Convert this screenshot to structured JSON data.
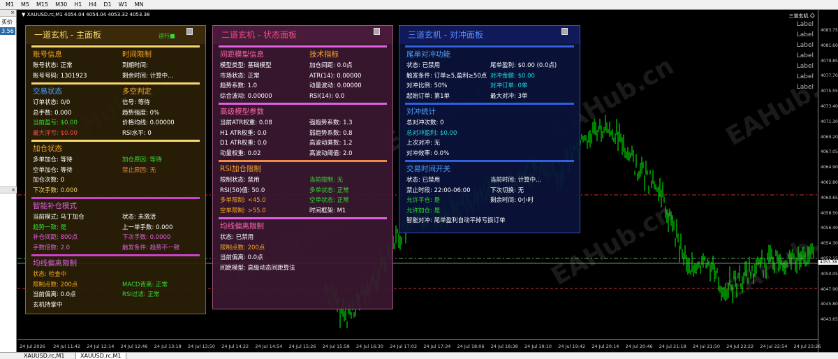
{
  "toolbar": {
    "items": [
      "M1",
      "M5",
      "M15",
      "M30",
      "H1",
      "H4",
      "D1",
      "W1",
      "MN"
    ]
  },
  "left": {
    "label": "买价",
    "value": "3.56"
  },
  "chart": {
    "title": "▼ XAUUSD.rc,M1   4054.04 4054.04 4053.32 4053.38",
    "ea_name": "三道玄机 ☺",
    "labels": [
      "Label",
      "Label",
      "Label",
      "Label",
      "Label",
      "Label",
      "Label"
    ]
  },
  "price_axis": [
    "4083.75",
    "4081.60",
    "4079.85",
    "4077.70",
    "4075.55",
    "4073.40",
    "4071.30",
    "4069.20",
    "4067.05",
    "4064.90",
    "4062.80",
    "4060.65",
    "4058.50",
    "4056.40",
    "4054.30",
    "4053.38",
    "4052.15",
    "4050.05",
    "4047.90",
    "4045.80",
    "4043.65"
  ],
  "time_axis": [
    "24 Jul 2026",
    "24 Jul 11:42",
    "24 Jul 12:14",
    "24 Jul 12:46",
    "24 Jul 13:18",
    "24 Jul 13:50",
    "24 Jul 14:22",
    "24 Jul 14:54",
    "24 Jul 15:26",
    "24 Jul 15:58",
    "24 Jul 16:30",
    "24 Jul 17:02",
    "24 Jul 17:34",
    "24 Jul 18:06",
    "24 Jul 18:38",
    "24 Jul 19:10",
    "24 Jul 19:42",
    "24 Jul 20:14",
    "24 Jul 20:46",
    "24 Jul 21:18",
    "24 Jul 21:50",
    "24 Jul 22:22",
    "24 Jul 22:54",
    "24 Jul 23:26"
  ],
  "tabs": [
    "XAUUSD.rc,M1",
    "XAUUSD.rc,M1"
  ],
  "watermark": "EAHub.cn",
  "colors": {
    "bull_bar": "#00ff00",
    "red_dash": "#cc3333",
    "green_dash": "#55aa55"
  },
  "panel1": {
    "title": "一道玄机 - 主面板",
    "status": "运行■",
    "sec1_a": "账号信息",
    "sec1_b": "时间限制",
    "r1a": "账号状态: 正常",
    "r1b": "到期时间:",
    "r2a": "账号号码: 1301923",
    "r2b": "剩余时间: 计算中...",
    "sec2_a": "交易状态",
    "sec2_b": "多空判定",
    "r3a": "订单状态: 0/0",
    "r3b": "信号: 等待",
    "r4a": "总手数: 0.000",
    "r4b": "趋势强度: 0%",
    "r5a": "当前盈亏: $0.00",
    "r5b": "价格均线: 0.00000",
    "r6a": "最大浮亏: $0.00",
    "r6b": "RSI水平: 0",
    "sec3": "加仓状态",
    "r7a": "多单加仓: 等待",
    "r7b": "加仓原因: 等待",
    "r8a": "空单加仓: 等待",
    "r8b": "禁止原因: 无",
    "r9a": "加仓次数: 0",
    "r10a": "下次手数: 0.000",
    "sec4": "智能补仓模式",
    "r11a": "当前模式: 马丁加仓",
    "r11b": "状态: 未激活",
    "r12a": "趋势一致: 是",
    "r12b": "上一单手数: 0.000",
    "r13a": "补仓间距: 800点",
    "r13b": "下次手数: 0.0000",
    "r14a": "手数倍数: 2.0",
    "r14b": "触发条件: 趋势不一致",
    "sec5": "均线偏离限制",
    "r15a": "状态: 检查中",
    "r16a": "限制点数: 200点",
    "r16b": "MACD背离: 正常",
    "r17a": "当前偏离: 0.0点",
    "r17b": "RSI过滤: 正常",
    "r18a": "玄机持掌中"
  },
  "panel2": {
    "title": "二道玄机 - 状态面板",
    "sec1_a": "间距模型信息",
    "sec1_b": "技术指标",
    "r1a": "模型类型: 基础模型",
    "r1b": "加仓间距: 0.0点",
    "r2a": "市场状态: 正常",
    "r2b": "ATR(14): 0.00000",
    "r3a": "趋势系数: 1.0",
    "r3b": "动量波动: 0.00000",
    "r4a": "综合波动: 0.00000",
    "r4b": "RSI(14): 0.0",
    "sec2": "高级模型参数",
    "r5a": "当前ATR权重: 0.08",
    "r5b": "强趋势系数: 1.3",
    "r6a": "H1 ATR权重: 0.0",
    "r6b": "弱趋势系数: 0.8",
    "r7a": "D1 ATR权重: 0.0",
    "r7b": "高波动乘数: 1.2",
    "r8a": "动量权重: 0.02",
    "r8b": "高波动阈值: 2.0",
    "sec3": "RSI加仓限制",
    "r9a": "限制状态: 禁用",
    "r9b": "当前限制: 无",
    "r10a": "RSI(50)值: 50.0",
    "r10b": "多单状态: 正常",
    "r11a": "多单限制: <45.0",
    "r11b": "空单状态: 正常",
    "r12a": "空单限制: >55.0",
    "r12b": "时间框架: M1",
    "sec4": "均线偏离限制",
    "r13a": "状态: 已禁用",
    "r14a": "限制点数: 200点",
    "r15a": "当前偏离: 0.0点",
    "r16a": "间距模型: 高级动态间距算法"
  },
  "panel3": {
    "title": "三道玄机 - 对冲面板",
    "sec1": "尾单对冲功能",
    "r1a": "状态: 已禁用",
    "r1b": "尾单盈利: $0.00 (0.0点)",
    "r2a": "触发条件: 订单≥5,盈利≥50点",
    "r2b": "对冲金额: $0.00",
    "r3a": "对冲比例: 50%",
    "r3b": "对冲订单: 0单",
    "r4a": "起始订单: 第1单",
    "r4b": "最大对冲: 3单",
    "sec2": "对冲统计",
    "r5a": "总对冲次数: 0",
    "r6a": "总对冲盈利: $0.00",
    "r7a": "上次对冲: 无",
    "r8a": "对冲效率: 0.0%",
    "sec3": "交易时间开关",
    "r9a": "状态: 已禁用",
    "r9b": "当前时间: 计算中...",
    "r10a": "禁止时段: 22:00-06:00",
    "r10b": "下次切换: 无",
    "r11a": "允许平仓: 是",
    "r11b": "剩余时间: 0小时",
    "r12a": "允许加仓: 是",
    "r13a": "智能对冲: 尾单盈利自动平掉亏损订单"
  }
}
